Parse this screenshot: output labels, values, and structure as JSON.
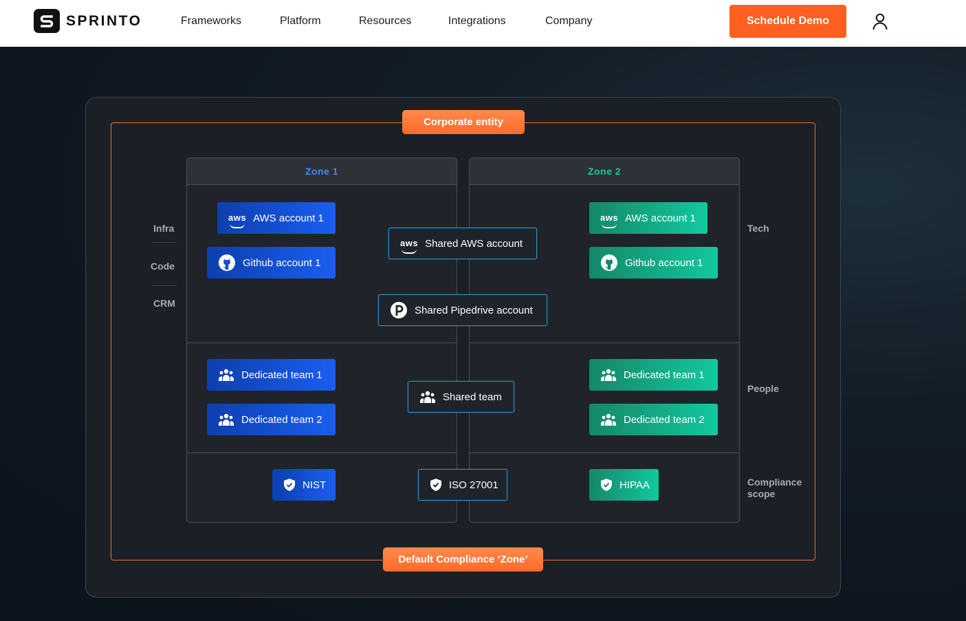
{
  "header": {
    "logo_text": "SPRINTO",
    "nav": [
      "Frameworks",
      "Platform",
      "Resources",
      "Integrations",
      "Company"
    ],
    "cta_label": "Schedule Demo",
    "accent_color": "#ff5f1f"
  },
  "diagram": {
    "top_label": "Corporate entity",
    "bottom_label": "Default Compliance ‘Zone’",
    "zone1": {
      "title": "Zone 1",
      "title_color": "#3d8bff",
      "aws": "AWS account 1",
      "github": "Github account 1",
      "team1": "Dedicated team 1",
      "team2": "Dedicated team 2",
      "scope": "NIST"
    },
    "zone2": {
      "title": "Zone 2",
      "title_color": "#16c9a0",
      "aws": "AWS account 1",
      "github": "Github account 1",
      "team1": "Dedicated team 1",
      "team2": "Dedicated team 2",
      "scope": "HIPAA"
    },
    "shared": {
      "aws": "Shared AWS account",
      "pipedrive": "Shared Pipedrive account",
      "team": "Shared team",
      "scope": "ISO 27001"
    },
    "left_labels": [
      "Infra",
      "Code",
      "CRM"
    ],
    "right_labels": {
      "tech": "Tech",
      "people": "People",
      "compliance_line1": "Compliance",
      "compliance_line2": "scope"
    },
    "icons": {
      "aws": "aws-logo-icon",
      "github": "github-icon",
      "pipedrive": "pipedrive-icon",
      "team": "team-icon",
      "shield": "shield-check-icon"
    }
  }
}
